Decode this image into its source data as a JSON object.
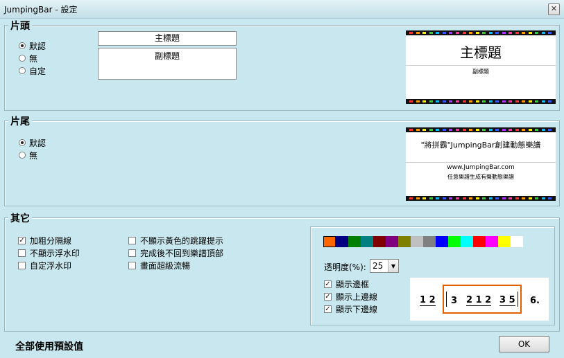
{
  "window": {
    "title": "JumpingBar - 設定",
    "close_glyph": "✕"
  },
  "header_section": {
    "title": "片頭",
    "options": [
      {
        "label": "默認",
        "selected": true
      },
      {
        "label": "無",
        "selected": false
      },
      {
        "label": "自定",
        "selected": false
      }
    ],
    "main_title_value": "主標題",
    "subtitle_value": "副標題",
    "preview": {
      "main_title": "主標題",
      "subtitle": "副標題"
    }
  },
  "footer_section": {
    "title": "片尾",
    "options": [
      {
        "label": "默認",
        "selected": true
      },
      {
        "label": "無",
        "selected": false
      }
    ],
    "preview": {
      "line1": "\"將拼霸\"JumpingBar創建動態樂譜",
      "line2": "www.JumpingBar.com",
      "line3": "任意樂譜生成有聲動態樂譜"
    }
  },
  "other_section": {
    "title": "其它",
    "checkboxes_col1": [
      {
        "label": "加粗分隔線",
        "checked": true
      },
      {
        "label": "不顯示浮水印",
        "checked": false
      },
      {
        "label": "自定浮水印",
        "checked": false
      }
    ],
    "checkboxes_col2": [
      {
        "label": "不顯示黃色的跳躍提示",
        "checked": false
      },
      {
        "label": "完成後不回到樂譜頂部",
        "checked": false
      },
      {
        "label": "畫面超級流暢",
        "checked": false
      }
    ],
    "colors": [
      "#ff6600",
      "#000080",
      "#008000",
      "#008080",
      "#800000",
      "#800080",
      "#808000",
      "#c0c0c0",
      "#808080",
      "#0000ff",
      "#00ff00",
      "#00ffff",
      "#ff0000",
      "#ff00ff",
      "#ffff00",
      "#ffffff"
    ],
    "selected_color": "#ff6600",
    "opacity_label": "透明度(%):",
    "opacity_value": "25",
    "border_options": [
      {
        "label": "顯示邊框",
        "checked": true
      },
      {
        "label": "顯示上邊線",
        "checked": true
      },
      {
        "label": "顯示下邊線",
        "checked": true
      }
    ],
    "notation_preview": {
      "left": "1 2",
      "box_a": "3",
      "box_b": "2 1 2",
      "box_c": "3 5",
      "right": "6."
    }
  },
  "bottom": {
    "reset_label": "全部使用預設值",
    "ok_label": "OK"
  },
  "film_colors": [
    "#ff3030",
    "#ff9900",
    "#ffee00",
    "#33cc33",
    "#00bbff",
    "#3355ff",
    "#aa33ff",
    "#ff33aa"
  ]
}
